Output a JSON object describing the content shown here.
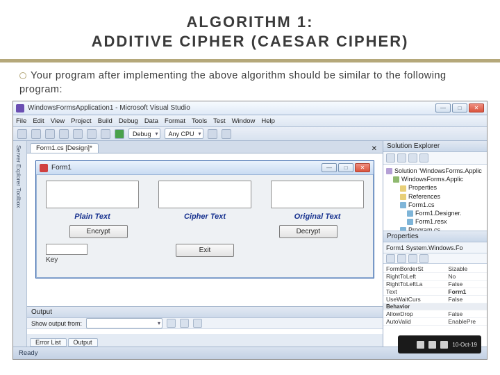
{
  "slide": {
    "title_line1": "ALGORITHM 1:",
    "title_line2": "ADDITIVE CIPHER (CAESAR CIPHER)",
    "bullet": "Your program after implementing the above algorithm should be similar to the following program:"
  },
  "vs": {
    "title": "WindowsFormsApplication1 - Microsoft Visual Studio",
    "menu": [
      "File",
      "Edit",
      "View",
      "Project",
      "Build",
      "Debug",
      "Data",
      "Format",
      "Tools",
      "Test",
      "Window",
      "Help"
    ],
    "combo_config": "Debug",
    "combo_platform": "Any CPU",
    "left_rail": "Server Explorer   Toolbox",
    "doc_tab": "Form1.cs [Design]*",
    "status": "Ready"
  },
  "form": {
    "title": "Form1",
    "labels": {
      "plain": "Plain Text",
      "cipher": "Cipher Text",
      "original": "Original Text",
      "key": "Key"
    },
    "buttons": {
      "encrypt": "Encrypt",
      "decrypt": "Decrypt",
      "exit": "Exit"
    }
  },
  "output": {
    "header": "Output",
    "show_from": "Show output from:",
    "tabs": [
      "Error List",
      "Output"
    ]
  },
  "solution": {
    "header": "Solution Explorer",
    "nodes": {
      "sln": "Solution 'WindowsForms.Applic",
      "proj": "WindowsForms.Applic",
      "props": "Properties",
      "refs": "References",
      "form": "Form1.cs",
      "designer": "Form1.Designer.",
      "resx": "Form1.resx",
      "program": "Program.cs"
    }
  },
  "properties": {
    "header": "Properties",
    "object": "Form1 System.Windows.Fo",
    "rows": [
      {
        "k": "FormBorderSt",
        "v": "Sizable"
      },
      {
        "k": "RightToLeft",
        "v": "No"
      },
      {
        "k": "RightToLeftLa",
        "v": "False"
      },
      {
        "k": "Text",
        "v": "Form1"
      },
      {
        "k": "UseWaitCurs",
        "v": "False"
      }
    ],
    "cat": "Behavior",
    "rows2": [
      {
        "k": "AllowDrop",
        "v": "False"
      },
      {
        "k": "AutoValid",
        "v": "EnablePre"
      }
    ]
  },
  "tray": {
    "time": "10-Oct-19"
  }
}
